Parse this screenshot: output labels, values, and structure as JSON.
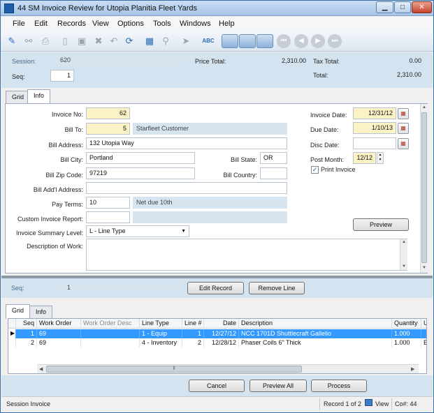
{
  "window": {
    "title": "44 SM Invoice Review for Utopia Planitia Fleet Yards",
    "minimize_glyph": "▁",
    "maximize_glyph": "□",
    "close_glyph": "✕"
  },
  "menu": [
    "File",
    "Edit",
    "Records",
    "View",
    "Options",
    "Tools",
    "Windows",
    "Help"
  ],
  "toolbar": {
    "icons": [
      "new-record-icon",
      "link-icon",
      "print-icon",
      "page-icon",
      "save-icon",
      "delete-icon",
      "undo-icon",
      "refresh-icon",
      "calculator-icon",
      "attach-icon",
      "send-icon",
      "spellcheck-icon",
      "layout-single-icon",
      "layout-split-icon",
      "first-record-icon",
      "previous-record-icon",
      "next-record-icon",
      "last-record-icon"
    ],
    "spellcheck_label": "ABC"
  },
  "header": {
    "session_label": "Session:",
    "session_value": "620",
    "seq_label": "Seq:",
    "seq_value": "1",
    "price_total_label": "Price Total:",
    "price_total_value": "2,310.00",
    "tax_total_label": "Tax Total:",
    "tax_total_value": "0.00",
    "total_label": "Total:",
    "total_value": "2,310.00"
  },
  "top_tabs": [
    "Grid",
    "Info"
  ],
  "form": {
    "invoice_no_label": "Invoice No:",
    "invoice_no": "62",
    "bill_to_label": "Bill To:",
    "bill_to_id": "5",
    "bill_to_name": "Starfleet Customer",
    "bill_address_label": "Bill Address:",
    "bill_address": "132 Utopia Way",
    "bill_city_label": "Bill City:",
    "bill_city": "Portland",
    "bill_state_label": "Bill State:",
    "bill_state": "OR",
    "bill_zip_label": "Bill Zip Code:",
    "bill_zip": "97219",
    "bill_country_label": "Bill Country:",
    "bill_country": "",
    "bill_add_address_label": "Bill Add'l Address:",
    "bill_add_address": "",
    "pay_terms_label": "Pay Terms:",
    "pay_terms_code": "10",
    "pay_terms_desc": "Net due 10th",
    "custom_report_label": "Custom Invoice Report:",
    "custom_report": "",
    "summary_level_label": "Invoice Summary Level:",
    "summary_level": "L - Line Type",
    "description_label": "Description of Work:",
    "description": "",
    "invoice_date_label": "Invoice Date:",
    "invoice_date": "12/31/12",
    "due_date_label": "Due Date:",
    "due_date": "1/10/13",
    "disc_date_label": "Disc Date:",
    "disc_date": "",
    "post_month_label": "Post Month:",
    "post_month": "12/12",
    "print_invoice_label": "Print Invoice",
    "print_invoice_checked": true,
    "calendar_glyph": "▦",
    "preview_label": "Preview"
  },
  "lines": {
    "seq_label": "Seq:",
    "seq_value": "1",
    "edit_record_label": "Edit Record",
    "remove_line_label": "Remove Line",
    "tabs": [
      "Grid",
      "Info"
    ],
    "columns": [
      "Seq",
      "Work Order",
      "Work Order Desc",
      "Line Type",
      "Line #",
      "Date",
      "Description",
      "Quantity",
      "U"
    ],
    "rows": [
      {
        "seq": "1",
        "work_order": "69",
        "work_order_desc": "",
        "line_type": "1 - Equip",
        "line_no": "1",
        "date": "12/27/12",
        "description": "NCC 1701D Shuttlecraft Gallelio",
        "quantity": "1.000",
        "u": ""
      },
      {
        "seq": "2",
        "work_order": "69",
        "work_order_desc": "",
        "line_type": "4 - Inventory",
        "line_no": "2",
        "date": "12/28/12",
        "description": "Phaser Coils 6\" Thick",
        "quantity": "1.000",
        "u": "E"
      }
    ],
    "scroll_thumb_glyph": "⦀"
  },
  "footer": {
    "cancel_label": "Cancel",
    "preview_all_label": "Preview All",
    "process_label": "Process"
  },
  "status": {
    "left": "Session Invoice",
    "record": "Record 1 of 2",
    "view": "View",
    "company": "Co#: 44"
  }
}
